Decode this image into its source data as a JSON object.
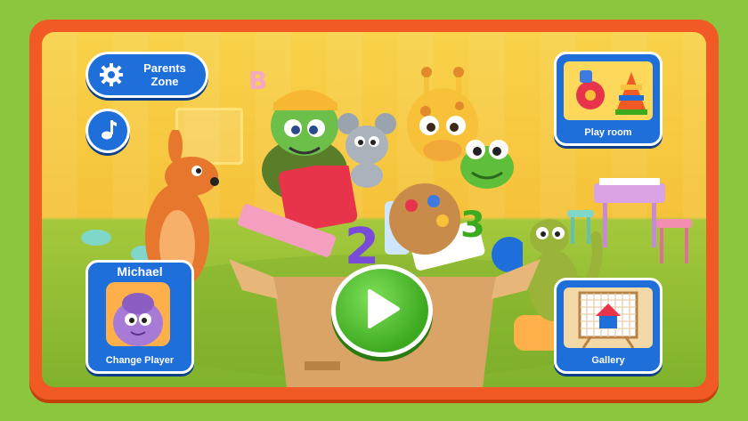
{
  "parents_zone": {
    "label_line1": "Parents",
    "label_line2": "Zone"
  },
  "music": {
    "icon": "music-note-icon"
  },
  "play_room": {
    "label": "Play room"
  },
  "player": {
    "name": "Michael",
    "action_label": "Change Player"
  },
  "gallery": {
    "label": "Gallery"
  },
  "play": {
    "icon": "play-icon"
  },
  "scene": {
    "wall_letter": "B"
  },
  "colors": {
    "accent_blue": "#1e6fd9",
    "frame_orange": "#f15a24",
    "play_green": "#3da91f",
    "background_green": "#8cc63f"
  }
}
